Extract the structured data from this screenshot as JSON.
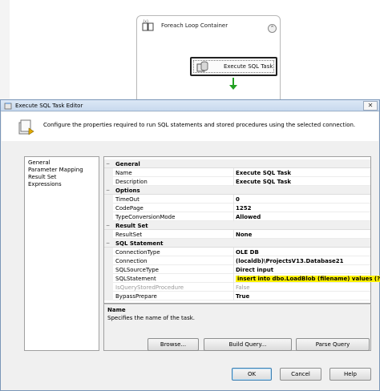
{
  "designer": {
    "container_title": "Foreach Loop Container",
    "collapse_glyph": "⌃",
    "task_label": "Execute SQL Task"
  },
  "dialog": {
    "title": "Execute SQL Task Editor",
    "close_glyph": "✕",
    "header_text": "Configure the properties required to run SQL statements and stored procedures using the selected connection.",
    "nav_items": [
      "General",
      "Parameter Mapping",
      "Result Set",
      "Expressions"
    ],
    "grid": {
      "categories": {
        "general": "General",
        "options": "Options",
        "result_set": "Result Set",
        "sql_statement": "SQL Statement"
      },
      "toggle_glyph": "−",
      "rows": {
        "name": {
          "name": "Name",
          "value": "Execute SQL Task"
        },
        "description": {
          "name": "Description",
          "value": "Execute SQL Task"
        },
        "timeout": {
          "name": "TimeOut",
          "value": "0"
        },
        "codepage": {
          "name": "CodePage",
          "value": "1252"
        },
        "type_conversion": {
          "name": "TypeConversionMode",
          "value": "Allowed"
        },
        "result_set": {
          "name": "ResultSet",
          "value": "None"
        },
        "connection_type": {
          "name": "ConnectionType",
          "value": "OLE DB"
        },
        "connection": {
          "name": "Connection",
          "value": "(localdb)\\ProjectsV13.Database21"
        },
        "sql_source_type": {
          "name": "SQLSourceType",
          "value": "Direct input"
        },
        "sql_statement": {
          "name": "SQLStatement",
          "value": "insert into dbo.LoadBlob (filename) values (?)"
        },
        "is_query_stored_procedure": {
          "name": "IsQueryStoredProcedure",
          "value": "False"
        },
        "bypass_prepare": {
          "name": "BypassPrepare",
          "value": "True"
        }
      }
    },
    "description": {
      "title": "Name",
      "text": "Specifies the name of the task."
    },
    "buttons": {
      "browse": "Browse...",
      "build_query": "Build Query...",
      "parse_query": "Parse Query",
      "ok": "OK",
      "cancel": "Cancel",
      "help": "Help"
    }
  },
  "colors": {
    "highlight": "#fff200",
    "connector": "#23a123",
    "titlebar": "#c8d9ee"
  }
}
